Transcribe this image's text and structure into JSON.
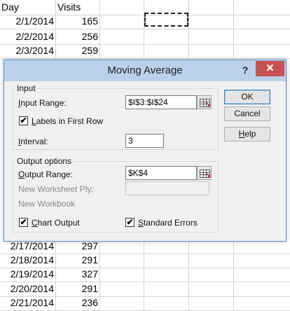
{
  "sheet": {
    "headers": [
      "Day",
      "Visits"
    ],
    "top_rows": [
      {
        "day": "2/1/2014",
        "visits": "165"
      },
      {
        "day": "2/2/2014",
        "visits": "256"
      },
      {
        "day": "2/3/2014",
        "visits": "259"
      }
    ],
    "bottom_rows": [
      {
        "day": "2/17/2014",
        "visits": "297"
      },
      {
        "day": "2/18/2014",
        "visits": "291"
      },
      {
        "day": "2/19/2014",
        "visits": "327"
      },
      {
        "day": "2/20/2014",
        "visits": "291"
      },
      {
        "day": "2/21/2014",
        "visits": "236"
      }
    ]
  },
  "dialog": {
    "title": "Moving Average",
    "help_label": "?",
    "close_label": "✕",
    "input_group": "Input",
    "input_range_label": "Input Range:",
    "input_range_value": "$I$3:$I$24",
    "labels_first_row_label": "Labels in First Row",
    "labels_first_row_checked": true,
    "interval_label": "Interval:",
    "interval_value": "3",
    "output_group": "Output options",
    "output_range_label": "Output Range:",
    "output_range_value": "$K$4",
    "new_ply_label": "New Worksheet Ply:",
    "new_workbook_label": "New Workbook",
    "chart_output_label": "Chart Output",
    "chart_output_checked": true,
    "standard_errors_label": "Standard Errors",
    "standard_errors_checked": true,
    "ok_label": "OK",
    "cancel_label": "Cancel",
    "help_button_label": "Help"
  }
}
